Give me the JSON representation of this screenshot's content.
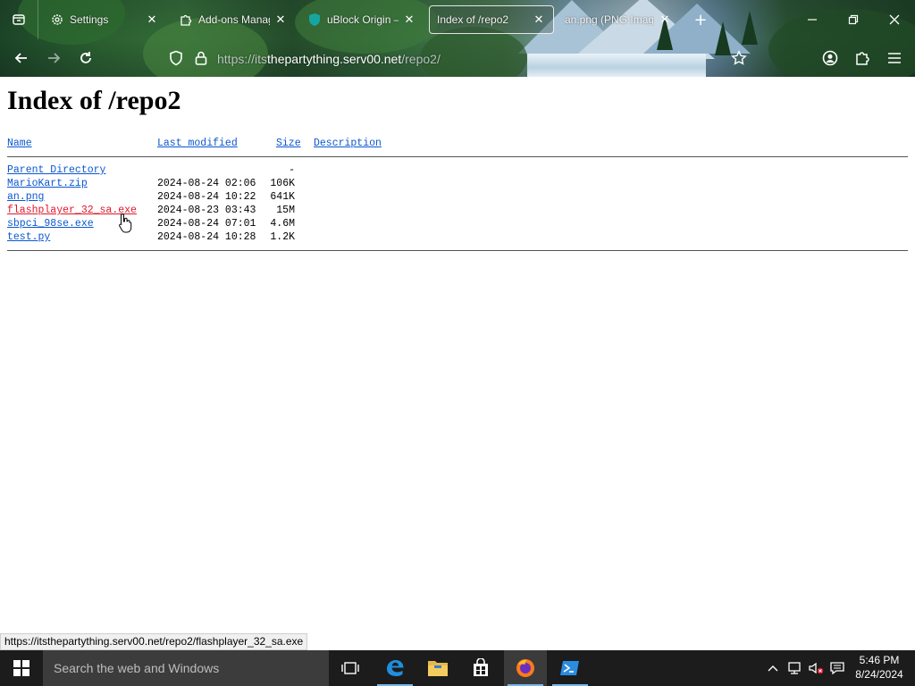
{
  "browser": {
    "tabs": [
      {
        "label": "Settings",
        "icon": "gear-icon",
        "active": false
      },
      {
        "label": "Add-ons Manager",
        "icon": "puzzle-icon",
        "active": false
      },
      {
        "label": "uBlock Origin – ",
        "icon": "ublock-icon",
        "active": false
      },
      {
        "label": "Index of /repo2",
        "icon": "none",
        "active": true
      },
      {
        "label": "an.png (PNG Image",
        "icon": "none",
        "active": false
      }
    ],
    "url_prefix": "https://its",
    "url_host": "thepartything.serv00.net",
    "url_path": "/repo2/"
  },
  "page": {
    "title": "Index of /repo2",
    "headers": {
      "name": "Name",
      "modified": "Last modified",
      "size": "Size",
      "description": "Description"
    },
    "rows": [
      {
        "name": "Parent Directory",
        "modified": "",
        "size": "-"
      },
      {
        "name": "MarioKart.zip",
        "modified": "2024-08-24 02:06",
        "size": "106K"
      },
      {
        "name": "an.png",
        "modified": "2024-08-24 10:22",
        "size": "641K"
      },
      {
        "name": "flashplayer_32_sa.exe",
        "modified": "2024-08-23 03:43",
        "size": "15M"
      },
      {
        "name": "sbpci_98se.exe",
        "modified": "2024-08-24 07:01",
        "size": "4.6M"
      },
      {
        "name": "test.py",
        "modified": "2024-08-24 10:28",
        "size": "1.2K"
      }
    ]
  },
  "status_url": "https://itsthepartything.serv00.net/repo2/flashplayer_32_sa.exe",
  "taskbar": {
    "search_placeholder": "Search the web and Windows",
    "time": "5:46 PM",
    "date": "8/24/2024"
  },
  "colors": {
    "link": "#0b57d0",
    "link_hover": "#e0162b",
    "taskbar": "#1c1c1c"
  }
}
